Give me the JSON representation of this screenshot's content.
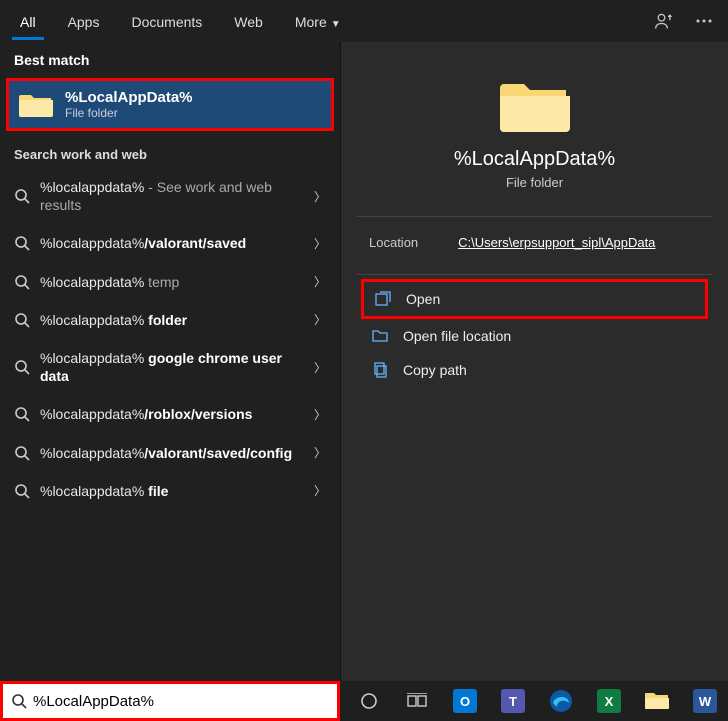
{
  "tabs": {
    "all": "All",
    "apps": "Apps",
    "documents": "Documents",
    "web": "Web",
    "more": "More"
  },
  "sections": {
    "best_match": "Best match",
    "search_work_web": "Search work and web"
  },
  "best_match": {
    "title": "%LocalAppData%",
    "subtitle": "File folder"
  },
  "results": [
    {
      "prefix": "%localappdata%",
      "suffix": " - See work and web results",
      "bold_suffix": ""
    },
    {
      "prefix": "%localappdata%",
      "suffix": "",
      "bold_suffix": "/valorant/saved"
    },
    {
      "prefix": "%localappdata%",
      "suffix": " temp",
      "bold_suffix": ""
    },
    {
      "prefix": "%localappdata%",
      "suffix": "",
      "bold_suffix": " folder"
    },
    {
      "prefix": "%localappdata%",
      "suffix": "",
      "bold_suffix": " google chrome user data"
    },
    {
      "prefix": "%localappdata%",
      "suffix": "",
      "bold_suffix": "/roblox/versions"
    },
    {
      "prefix": "%localappdata%",
      "suffix": "",
      "bold_suffix": "/valorant/saved/config"
    },
    {
      "prefix": "%localappdata%",
      "suffix": "",
      "bold_suffix": " file"
    }
  ],
  "preview": {
    "title": "%LocalAppData%",
    "subtitle": "File folder",
    "location_label": "Location",
    "location_path": "C:\\Users\\erpsupport_sipl\\AppData"
  },
  "actions": {
    "open": "Open",
    "open_location": "Open file location",
    "copy_path": "Copy path"
  },
  "search": {
    "value": "%LocalAppData%"
  },
  "taskbar": {
    "cortana": "cortana-icon",
    "taskview": "task-view-icon",
    "apps": [
      "outlook",
      "teams",
      "edge",
      "excel",
      "file-explorer",
      "word"
    ]
  }
}
